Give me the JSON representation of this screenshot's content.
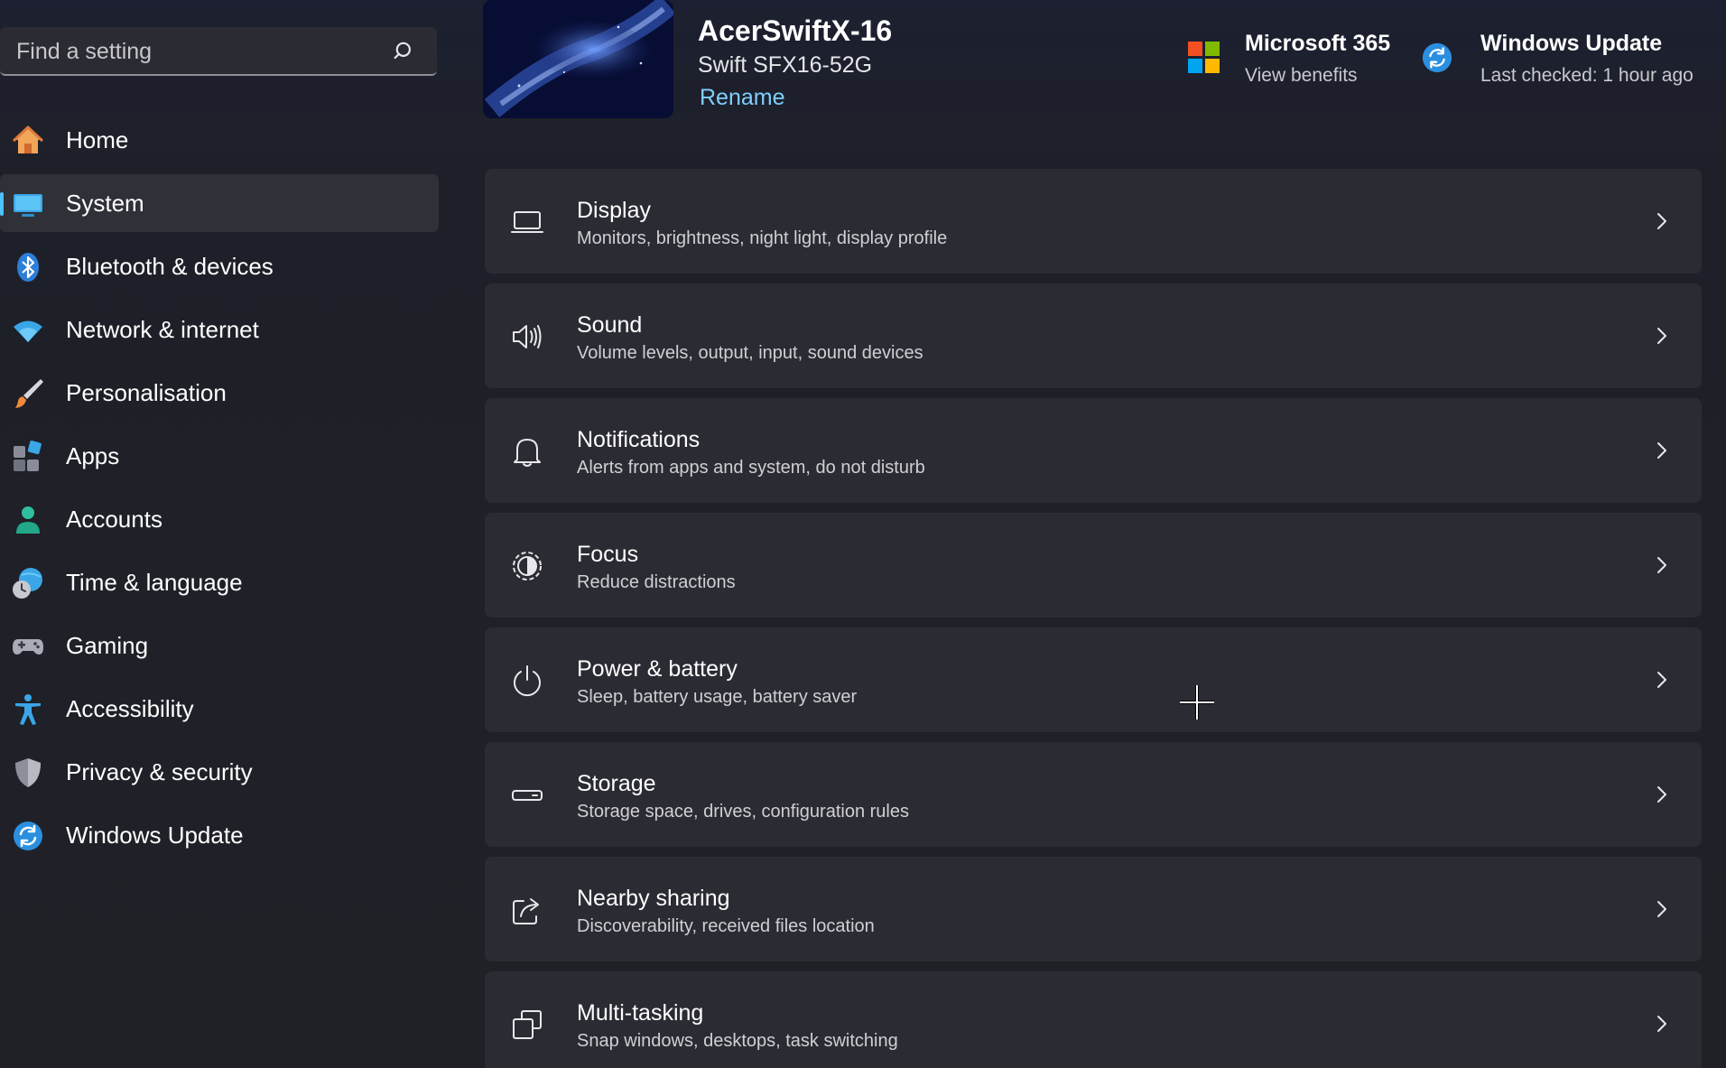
{
  "sidebar": {
    "search": {
      "placeholder": "Find a setting",
      "value": ""
    },
    "items": [
      {
        "label": "Home",
        "icon": "home-icon",
        "active": false
      },
      {
        "label": "System",
        "icon": "system-icon",
        "active": true
      },
      {
        "label": "Bluetooth & devices",
        "icon": "bluetooth-icon",
        "active": false
      },
      {
        "label": "Network & internet",
        "icon": "wifi-icon",
        "active": false
      },
      {
        "label": "Personalisation",
        "icon": "paintbrush-icon",
        "active": false
      },
      {
        "label": "Apps",
        "icon": "apps-icon",
        "active": false
      },
      {
        "label": "Accounts",
        "icon": "account-icon",
        "active": false
      },
      {
        "label": "Time & language",
        "icon": "globe-clock-icon",
        "active": false
      },
      {
        "label": "Gaming",
        "icon": "gamepad-icon",
        "active": false
      },
      {
        "label": "Accessibility",
        "icon": "accessibility-icon",
        "active": false
      },
      {
        "label": "Privacy & security",
        "icon": "shield-icon",
        "active": false
      },
      {
        "label": "Windows Update",
        "icon": "windows-update-icon",
        "active": false
      }
    ]
  },
  "header": {
    "device_name": "AcerSwiftX-16",
    "device_model": "Swift SFX16-52G",
    "rename_label": "Rename",
    "microsoft365": {
      "title": "Microsoft 365",
      "subtitle": "View benefits"
    },
    "windows_update": {
      "title": "Windows Update",
      "subtitle": "Last checked: 1 hour ago"
    }
  },
  "cards": [
    {
      "title": "Display",
      "subtitle": "Monitors, brightness, night light, display profile",
      "icon": "display-icon"
    },
    {
      "title": "Sound",
      "subtitle": "Volume levels, output, input, sound devices",
      "icon": "speaker-icon"
    },
    {
      "title": "Notifications",
      "subtitle": "Alerts from apps and system, do not disturb",
      "icon": "bell-icon"
    },
    {
      "title": "Focus",
      "subtitle": "Reduce distractions",
      "icon": "focus-icon"
    },
    {
      "title": "Power & battery",
      "subtitle": "Sleep, battery usage, battery saver",
      "icon": "power-icon"
    },
    {
      "title": "Storage",
      "subtitle": "Storage space, drives, configuration rules",
      "icon": "storage-icon"
    },
    {
      "title": "Nearby sharing",
      "subtitle": "Discoverability, received files location",
      "icon": "share-icon"
    },
    {
      "title": "Multi-tasking",
      "subtitle": "Snap windows, desktops, task switching",
      "icon": "multitasking-icon"
    }
  ],
  "colors": {
    "accent": "#4cc2ff",
    "link": "#7fd0ff",
    "card_bg": "#2b2c33",
    "page_bg": "#202127"
  }
}
